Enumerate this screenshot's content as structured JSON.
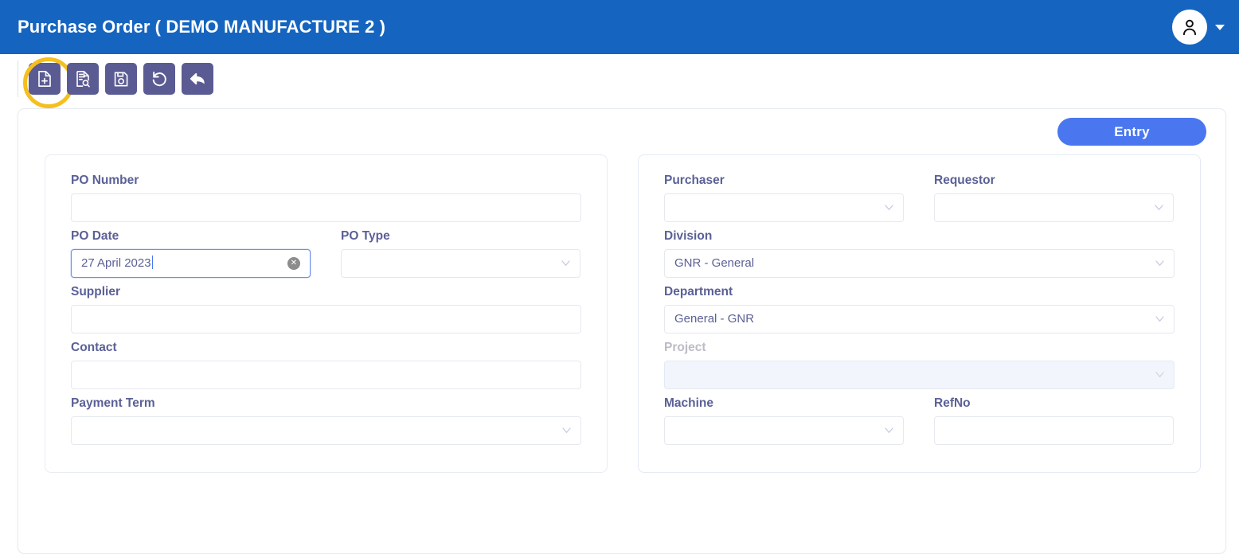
{
  "header": {
    "title": "Purchase Order ( DEMO MANUFACTURE 2 )",
    "background_color": "#1565c0",
    "avatar_icon": "user-avatar-icon",
    "dropdown_icon": "caret-down-icon"
  },
  "toolbar": {
    "button_color": "#5b5b93",
    "highlight_color": "#f5bf1d",
    "buttons": [
      {
        "name": "new-document",
        "icon": "file-plus-icon",
        "highlighted": true
      },
      {
        "name": "search-document",
        "icon": "document-search-icon",
        "highlighted": false
      },
      {
        "name": "save-document",
        "icon": "floppy-save-icon",
        "highlighted": false
      },
      {
        "name": "refresh",
        "icon": "undo-circle-icon",
        "highlighted": false
      },
      {
        "name": "back",
        "icon": "arrow-back-icon",
        "highlighted": false
      }
    ]
  },
  "main": {
    "entry_button_label": "Entry",
    "entry_button_color": "#4a77ef",
    "left_panel": {
      "po_number": {
        "label": "PO Number",
        "value": "",
        "type": "text"
      },
      "po_date": {
        "label": "PO Date",
        "value": "27 April 2023",
        "type": "text",
        "focused": true,
        "clear_icon": "circle-x-icon"
      },
      "po_type": {
        "label": "PO Type",
        "value": "",
        "type": "select"
      },
      "supplier": {
        "label": "Supplier",
        "value": "",
        "type": "text"
      },
      "contact": {
        "label": "Contact",
        "value": "",
        "type": "text"
      },
      "payment_term": {
        "label": "Payment Term",
        "value": "",
        "type": "select"
      }
    },
    "right_panel": {
      "purchaser": {
        "label": "Purchaser",
        "value": "",
        "type": "select"
      },
      "requestor": {
        "label": "Requestor",
        "value": "",
        "type": "select"
      },
      "division": {
        "label": "Division",
        "value": "GNR - General",
        "type": "select"
      },
      "department": {
        "label": "Department",
        "value": "General - GNR",
        "type": "select"
      },
      "project": {
        "label": "Project",
        "value": "",
        "type": "select",
        "disabled": true
      },
      "machine": {
        "label": "Machine",
        "value": "",
        "type": "select"
      },
      "refno": {
        "label": "RefNo",
        "value": "",
        "type": "text"
      }
    }
  }
}
